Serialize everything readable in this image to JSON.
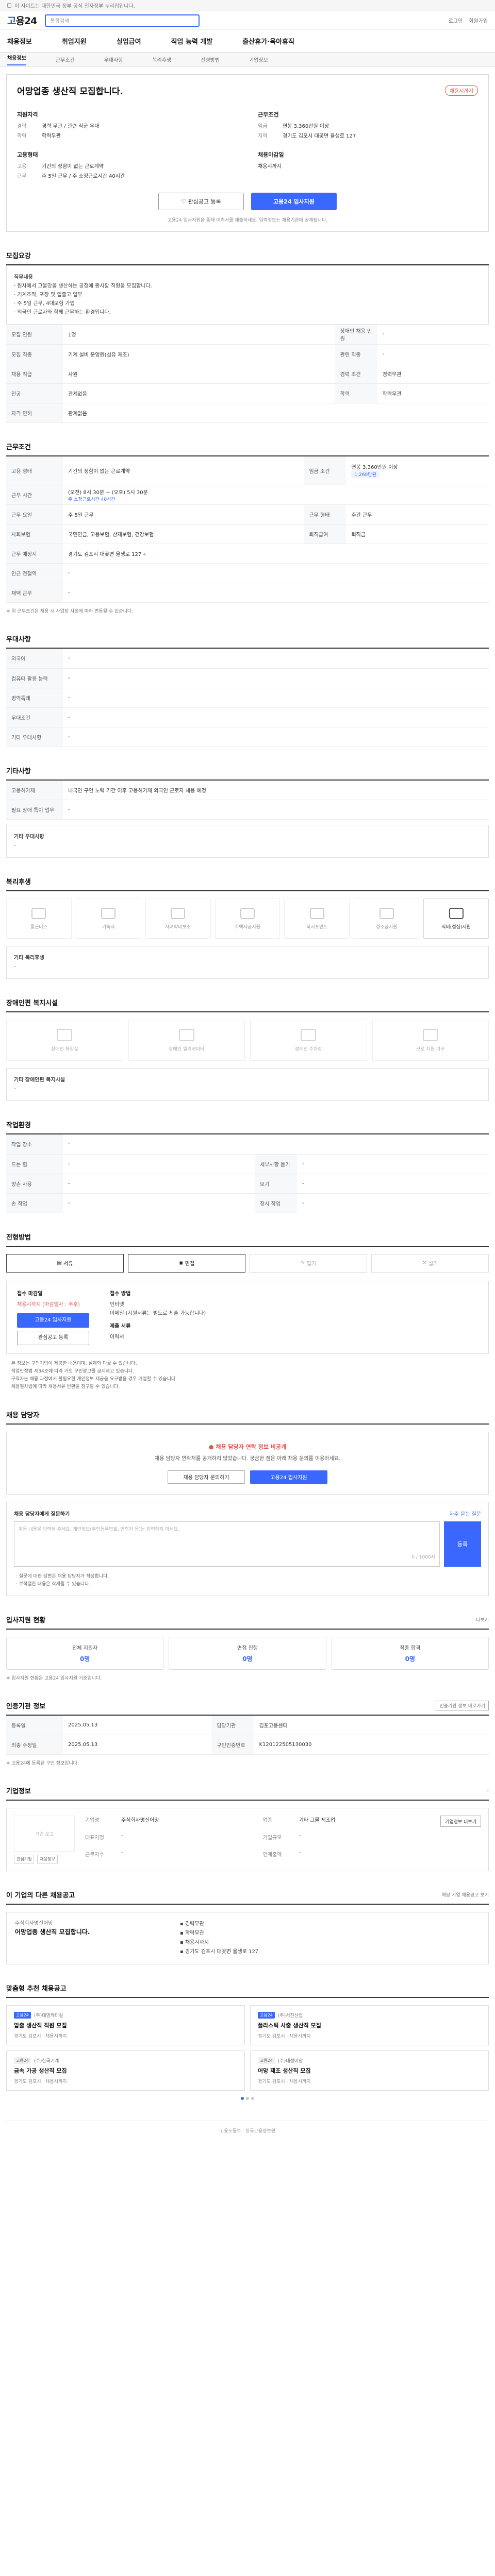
{
  "topbar": {
    "text": "이 사이트는 대한민국 정부 공식 전자정부 누리집입니다."
  },
  "brand": {
    "prefix": "고",
    "name": "용24"
  },
  "search": {
    "placeholder": "통합검색"
  },
  "header_links": {
    "login": "로그인",
    "join": "회원가입"
  },
  "gnb": [
    "채용정보",
    "취업지원",
    "실업급여",
    "직업 능력 개발",
    "출산휴가·육아휴직"
  ],
  "tabs": [
    "채용정보",
    "근무조건",
    "우대사항",
    "복리후생",
    "전형방법",
    "기업정보"
  ],
  "job": {
    "title": "어망업종 생산직 모집합니다.",
    "status": "채용시까지",
    "qual_h": "지원자격",
    "qual": [
      {
        "k": "경력",
        "v": "경력 무관 / 관련 직군 우대"
      },
      {
        "k": "학력",
        "v": "학력무관"
      }
    ],
    "cond_h": "근무조건",
    "cond": [
      {
        "k": "임금",
        "v": "연봉 3,360만원 이상"
      },
      {
        "k": "지역",
        "v": "경기도 김포시 대곶면 율생로 127"
      }
    ],
    "form_h": "고용형태",
    "form": [
      {
        "k": "고용",
        "v": "기간의 정함이 없는 근로계약"
      },
      {
        "k": "근무",
        "v": "주 5일 근무 / 주 소정근로시간 40시간"
      }
    ],
    "due_h": "채용마감일",
    "due": "채용시까지",
    "btn_scrap": "관심공고 등록",
    "btn_apply": "고용24 입사지원",
    "note": "고용24 입사지원을 통해 이력서를 제출하세요. 입력정보는 채용기관에 공개됩니다."
  },
  "recruit": {
    "title": "모집요강",
    "desc": [
      "직무내용",
      "· 원사에서 그물망을 생산하는 공정에 종사할 직원을 모집합니다.",
      "· 기계조작, 포장 및 입출고 업무",
      "· 주 5일 근무, 4대보험 가입",
      "· 외국인 근로자와 함께 근무하는 환경입니다."
    ],
    "rows": [
      {
        "k": "모집 인원",
        "v": "1명",
        "k2": "장애인 채용 인원",
        "v2": "-"
      },
      {
        "k": "모집 직종",
        "v": "기계 설비 운영원(섬유 제조)",
        "k2": "관련 직종",
        "v2": "-"
      },
      {
        "k": "채용 직급",
        "v": "사원",
        "k2": "경력 조건",
        "v2": "경력무관"
      },
      {
        "k": "전공",
        "v": "관계없음",
        "k2": "학력",
        "v2": "학력무관"
      },
      {
        "k": "자격 면허",
        "v": "관계없음",
        "k2": "",
        "v2": ""
      }
    ]
  },
  "work": {
    "title": "근무조건",
    "rows": [
      {
        "k": "고용 형태",
        "v": "기간의 정함이 없는 근로계약",
        "k2": "임금 조건",
        "v2": "연봉 3,360만원 이상"
      },
      {
        "k": "근무 시간",
        "v": "(오전) 8시 30분 ~ (오후) 5시 30분",
        "k2": "",
        "v2": ""
      },
      {
        "k": "근무 요일",
        "v": "주 5일 근무",
        "k2": "근무 형태",
        "v2": "주간 근무"
      },
      {
        "k": "사회보험",
        "v": "국민연금, 고용보험, 산재보험, 건강보험",
        "k2": "퇴직급여",
        "v2": "퇴직금"
      },
      {
        "k": "근무 예정지",
        "v": "경기도 김포시 대곶면 율생로 127",
        "k2": "",
        "v2": ""
      },
      {
        "k": "인근 전철역",
        "v": "-",
        "k2": "",
        "v2": ""
      },
      {
        "k": "재택 근무",
        "v": "-",
        "k2": "",
        "v2": ""
      }
    ],
    "salary_chip": "1,260만원",
    "week_label": "주 소정근로시간 40시간",
    "note": "※ 위 근무조건은 채용 시 사업장 사정에 따라 변동될 수 있습니다."
  },
  "pref": {
    "title": "우대사항",
    "rows": [
      {
        "k": "외국어",
        "v": "-"
      },
      {
        "k": "컴퓨터 활용 능력",
        "v": "-"
      },
      {
        "k": "병역특례",
        "v": "-"
      },
      {
        "k": "우대조건",
        "v": "-"
      },
      {
        "k": "기타 우대사항",
        "v": "-"
      }
    ]
  },
  "etc": {
    "title": "기타사항",
    "rows": [
      {
        "k": "고용허가제",
        "v": "내국인 구인 노력 기간 이후 고용허가제 외국인 근로자 채용 예정"
      },
      {
        "k": "필요 장애 특이 업무",
        "v": "-"
      }
    ],
    "desc_h": "기타 우대사항",
    "desc": "-"
  },
  "welfare": {
    "title": "복리후생",
    "items": [
      "통근버스",
      "기숙사",
      "자녀학비보조",
      "주택자금지원",
      "복지포인트",
      "경조금지원",
      "식비(점심)지원"
    ],
    "active": [
      6
    ],
    "etc_h": "기타 복리후생",
    "etc": "-"
  },
  "disab": {
    "title": "장애인편 복지시설",
    "items": [
      "장애인 화장실",
      "장애인 엘리베이터",
      "장애인 주차장",
      "근로 지원 기구"
    ],
    "etc_h": "기타 장애인편 복지시설",
    "etc": "-"
  },
  "env": {
    "title": "작업환경",
    "rows": [
      {
        "k": "작업 장소",
        "v": "-",
        "k2": "",
        "v2": ""
      },
      {
        "k": "드는 힘",
        "v": "-",
        "k2": "세부사항 듣기",
        "v2": "-"
      },
      {
        "k": "양손 사용",
        "v": "-",
        "k2": "보기",
        "v2": "-"
      },
      {
        "k": "손 작업",
        "v": "-",
        "k2": "장시 작업",
        "v2": "-"
      }
    ]
  },
  "process": {
    "title": "전형방법",
    "steps": [
      "서류",
      "면접",
      "필기",
      "실기"
    ],
    "active": [
      0,
      1
    ],
    "apply_h": "접수 마감일",
    "apply_v": "채용시까지 (마감일자 : 추후)",
    "btn1": "고용24 입사지원",
    "btn2": "관심공고 등록",
    "doc_h": "접수 방법",
    "doc": [
      "인터넷",
      "이메일 (지원서류는 별도로 제출 가능합니다)"
    ],
    "form_h": "제출 서류",
    "form": "이력서",
    "notes": [
      "· 본 정보는 구인기업이 제공한 내용이며, 실제와 다를 수 있습니다.",
      "· 직업안정법 제34조에 따라 거짓 구인광고를 금지하고 있습니다.",
      "· 구직자는 채용 과정에서 불필요한 개인정보 제공을 요구받을 경우 거절할 수 있습니다.",
      "· 채용절차법에 따라 채용서류 반환을 청구할 수 있습니다."
    ]
  },
  "contact": {
    "title": "채용 담당자",
    "warn": "채용 담당자 연락 정보 비공개",
    "text": "채용 담당자 연락처를 공개하지 않았습니다. 궁금한 점은 아래 채용 문의를 이용하세요.",
    "btn1": "채용 담당자 문의하기",
    "btn2": "고용24 입사지원"
  },
  "qna": {
    "title": "채용 담당자에게 질문하기",
    "link": "자주 묻는 질문",
    "placeholder": "질문 내용을 입력해 주세요. 개인정보(주민등록번호, 연락처 등)는 입력하지 마세요.",
    "count": "0 / 1000자",
    "btn": "등록",
    "notes": [
      "· 질문에 대한 답변은 채용 담당자가 작성합니다.",
      "· 부적절한 내용은 삭제될 수 있습니다."
    ]
  },
  "status": {
    "title": "입사지원 현황",
    "more": "더보기",
    "cards": [
      {
        "label": "전체 지원자",
        "value": "0명"
      },
      {
        "label": "면접 진행",
        "value": "0명"
      },
      {
        "label": "최종 합격",
        "value": "0명"
      }
    ],
    "note": "※ 입사지원 현황은 고용24 입사지원 기준입니다."
  },
  "reg": {
    "title": "인증기관 정보",
    "btn": "인증기관 정보 바로가기",
    "rows": [
      {
        "k": "등록일",
        "v": "2025.05.13",
        "k2": "담당기관",
        "v2": "김포고용센터"
      },
      {
        "k": "최종 수정일",
        "v": "2025.05.13",
        "k2": "구인인증번호",
        "v2": "K120122505130030"
      }
    ],
    "note": "※ 고용24에 등록된 구인 정보입니다."
  },
  "company": {
    "title": "기업정보",
    "logo": "기업 로고",
    "mini": [
      "관심기업",
      "채용정보"
    ],
    "info": [
      {
        "k": "기업명",
        "v": "주식회사명신어망"
      },
      {
        "k": "업종",
        "v": "기타 그물 제조업"
      },
      {
        "k": "대표자명",
        "v": "-"
      },
      {
        "k": "기업규모",
        "v": "-"
      },
      {
        "k": "근로자수",
        "v": "-"
      },
      {
        "k": "연매출액",
        "v": "-"
      }
    ],
    "btn": "기업정보 더보기"
  },
  "related": {
    "title": "이 기업의 다른 채용공고",
    "sub": "해당 기업 채용공고 보기",
    "company": "주식회사명신어망",
    "job_title": "어망업종 생산직 모집합니다.",
    "meta": [
      "경력무관",
      "학력무관",
      "채용시까지"
    ],
    "addr": "경기도 김포시 대곶면 율생로 127"
  },
  "similar": {
    "title": "맞춤형 추천 채용공고",
    "cards": [
      {
        "tag": "고용24",
        "co": "(주)대명케미칼",
        "title": "압출 생산직 직원 모집",
        "meta": "경기도 김포시 · 채용시까지"
      },
      {
        "tag": "고용24",
        "co": "(주)서진산업",
        "title": "플라스틱 사출 생산직 모집",
        "meta": "경기도 김포시 · 채용시까지"
      },
      {
        "tag": "고용24",
        "co": "(주)한국기계",
        "title": "금속 가공 생산직 모집",
        "meta": "경기도 김포시 · 채용시까지"
      },
      {
        "tag": "고용24",
        "co": "(주)태성어망",
        "title": "어망 제조 생산직 모집",
        "meta": "경기도 김포시 · 채용시까지"
      }
    ]
  },
  "footer": "고용노동부 · 한국고용정보원"
}
